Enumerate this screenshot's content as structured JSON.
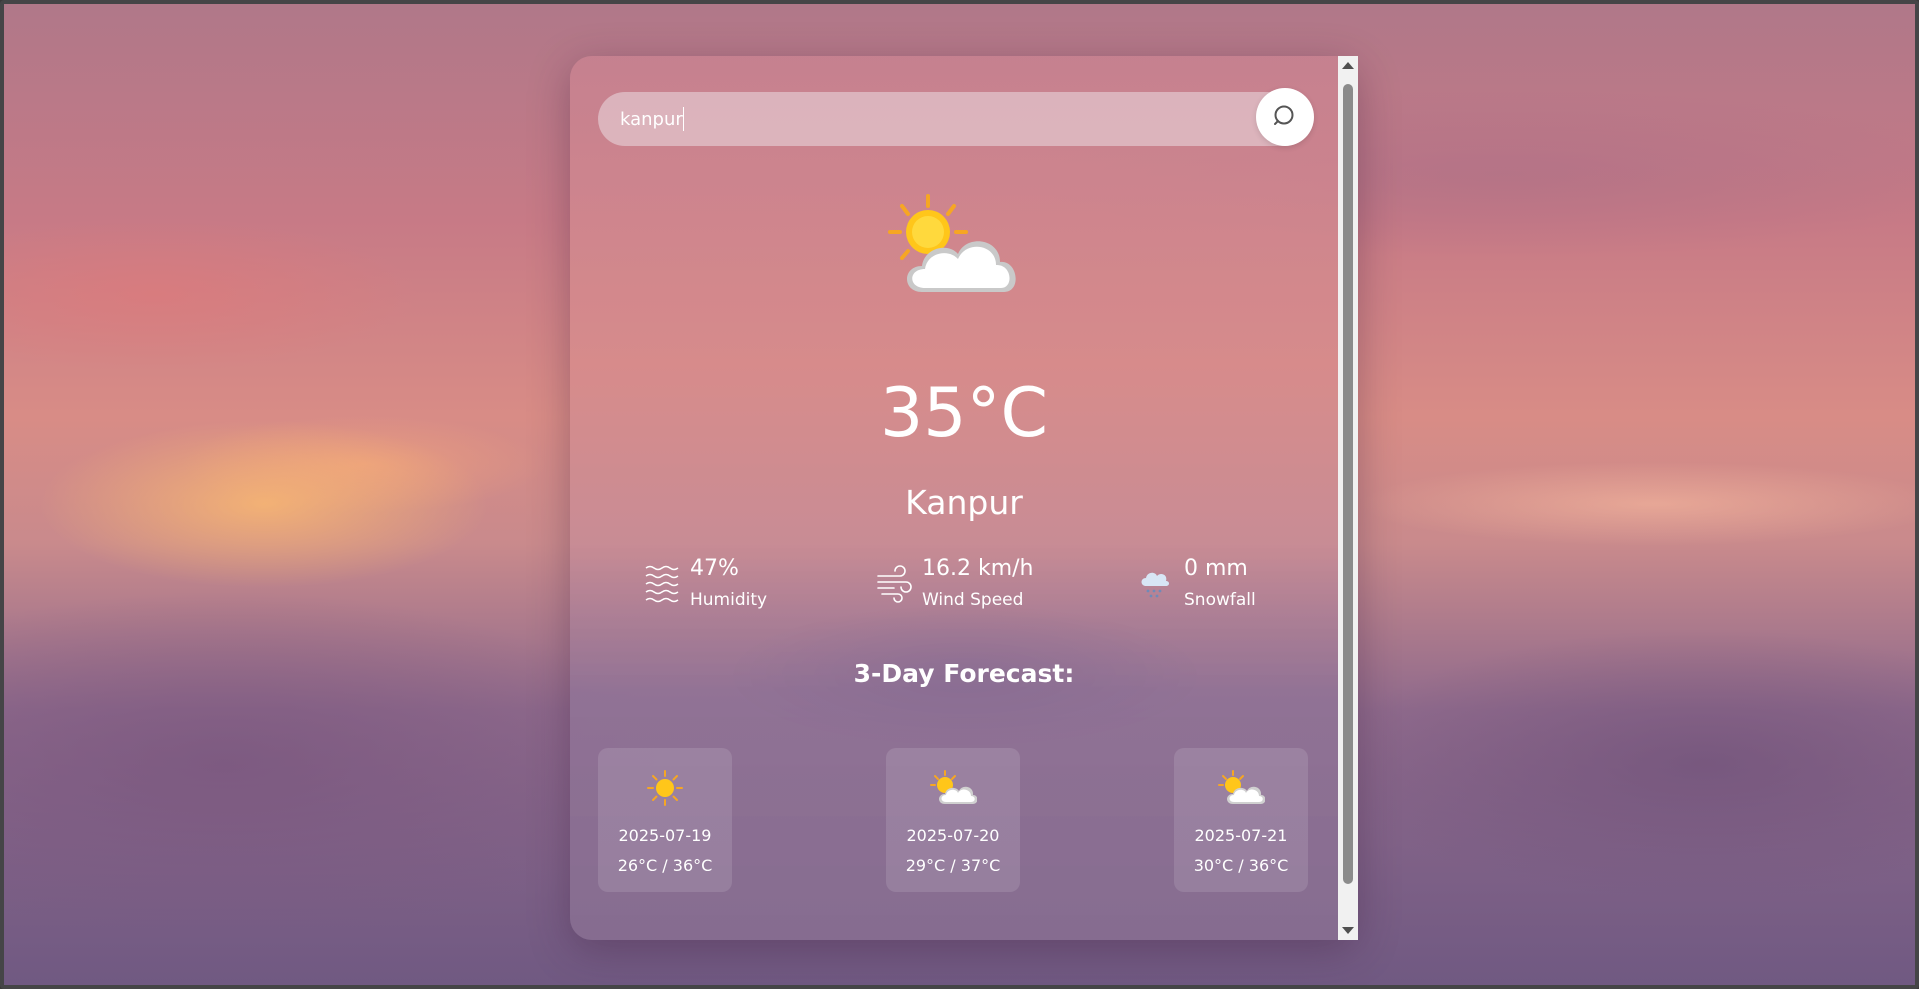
{
  "search": {
    "value": "kanpur",
    "button_icon": "search-icon"
  },
  "current": {
    "icon": "sun-behind-cloud-icon",
    "temperature": "35°C",
    "city": "Kanpur"
  },
  "stats": {
    "humidity": {
      "icon": "humidity-waves-icon",
      "value": "47%",
      "label": "Humidity"
    },
    "wind": {
      "icon": "wind-icon",
      "value": "16.2 km/h",
      "label": "Wind Speed"
    },
    "snowfall": {
      "icon": "snow-cloud-icon",
      "value": "0 mm",
      "label": "Snowfall"
    }
  },
  "forecast": {
    "title": "3-Day Forecast:",
    "days": [
      {
        "icon": "sun-icon",
        "date": "2025-07-19",
        "range": "26°C / 36°C"
      },
      {
        "icon": "sun-behind-cloud-icon",
        "date": "2025-07-20",
        "range": "29°C / 37°C"
      },
      {
        "icon": "sun-behind-cloud-icon",
        "date": "2025-07-21",
        "range": "30°C / 36°C"
      }
    ]
  }
}
